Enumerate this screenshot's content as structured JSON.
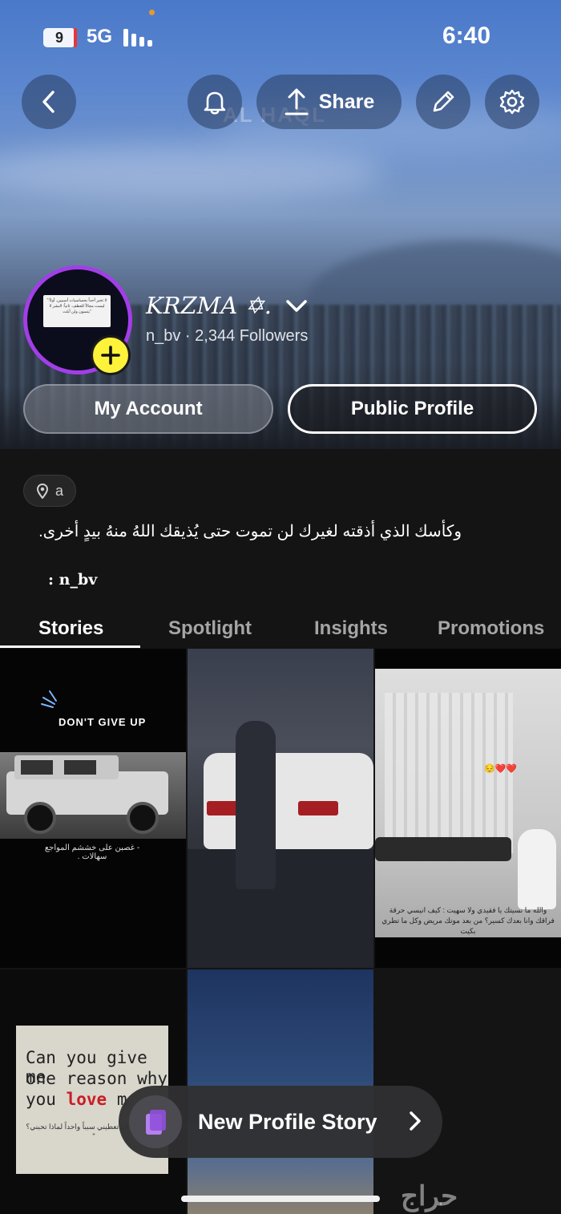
{
  "status_bar": {
    "sim_label": "9",
    "network": "5G",
    "time": "6:40"
  },
  "header": {
    "watermark": "AL HAQL",
    "share_label": "Share",
    "icons": [
      "back-icon",
      "bell-icon",
      "share-icon",
      "pencil-icon",
      "gear-icon"
    ]
  },
  "profile": {
    "display_name": "KRZMA ✡︎.",
    "username": "n_bv",
    "followers": "2,344 Followers",
    "subtitle": "n_bv · 2,344 Followers",
    "avatar_text": "\"لا تخبر أحداً بحساسيات أسبيين. أولاً: ليست مجالاً للعطف. ثانياً: البشر لا يتسون ولن أبلت\"",
    "accent_color": "#a23ee8",
    "add_button_color": "#fff23a"
  },
  "buttons": {
    "my_account": "My Account",
    "public_profile": "Public Profile"
  },
  "info": {
    "location": "a",
    "bio": "وكأسك الذي أذقته لغيرك لن تموت حتى يُذيقك اللهُ منهُ بيدٍ أخرى.",
    "bio_line2": ": n_bv"
  },
  "tabs": [
    {
      "label": "Stories",
      "active": true
    },
    {
      "label": "Spotlight",
      "active": false
    },
    {
      "label": "Insights",
      "active": false
    },
    {
      "label": "Promotions",
      "active": false
    }
  ],
  "stories": {
    "tile1_title": "DON'T GIVE UP",
    "tile1_caption": "- غصبن على خششم المواجع سهالات .",
    "tile3_emojis": "😔❤️❤️",
    "tile3_caption": "والله ما نسيتك يا فقيدي ولا سهيت : كيف انيسي حرقة فراقك وانا بعدك كسير؟ من بعد موتك مريض وكل ما تطري بكيت",
    "tile4_line1": "Can you give me",
    "tile4_line2": "one reason why",
    "tile4_line3a": "you",
    "tile4_line3b": "love",
    "tile4_line3c": "m",
    "tile4_caption": "\" هل يمكن ان تعطيني سبباً واحداً لماذا تحبني؟ \""
  },
  "floating": {
    "new_profile_story": "New Profile Story"
  },
  "footer": {
    "watermark": "حراج"
  }
}
